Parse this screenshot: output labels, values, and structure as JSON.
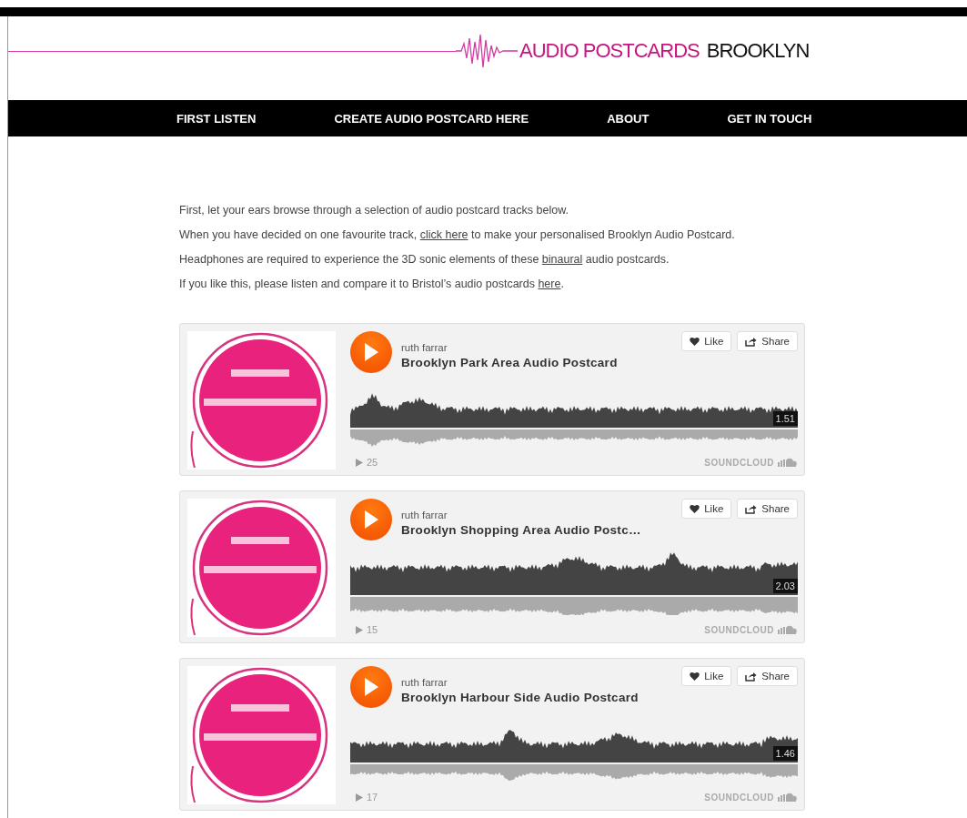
{
  "logo": {
    "primary": "AUDIO POSTCARDS",
    "secondary": "BROOKLYN"
  },
  "nav": [
    {
      "label": "FIRST LISTEN"
    },
    {
      "label": "CREATE AUDIO POSTCARD HERE"
    },
    {
      "label": "ABOUT"
    },
    {
      "label": "GET IN TOUCH"
    }
  ],
  "intro": [
    [
      {
        "kind": "text",
        "text": "First, let your ears browse through a selection of audio postcard tracks below."
      }
    ],
    [
      {
        "kind": "text",
        "text": "When you have decided on one favourite track, "
      },
      {
        "kind": "link",
        "text": "click here"
      },
      {
        "kind": "text",
        "text": " to make your personalised Brooklyn Audio Postcard."
      }
    ],
    [
      {
        "kind": "text",
        "text": "Headphones are required to experience the 3D sonic elements of these "
      },
      {
        "kind": "link",
        "text": "binaural"
      },
      {
        "kind": "text",
        "text": " audio postcards."
      }
    ],
    [
      {
        "kind": "text",
        "text": "If you like this, please listen and compare it to Bristol’s audio postcards "
      },
      {
        "kind": "link",
        "text": "here"
      },
      {
        "kind": "text",
        "text": "."
      }
    ]
  ],
  "players": [
    {
      "artist": "ruth farrar",
      "title": "Brooklyn Park Area Audio Postcard",
      "duration": "1.51",
      "plays": "25",
      "like": "Like",
      "share": "Share",
      "brand": "SOUNDCLOUD"
    },
    {
      "artist": "ruth farrar",
      "title": "Brooklyn Shopping Area Audio Postc…",
      "duration": "2.03",
      "plays": "15",
      "like": "Like",
      "share": "Share",
      "brand": "SOUNDCLOUD"
    },
    {
      "artist": "ruth farrar",
      "title": "Brooklyn Harbour Side Audio Postcard",
      "duration": "1.46",
      "plays": "17",
      "like": "Like",
      "share": "Share",
      "brand": "SOUNDCLOUD"
    }
  ]
}
